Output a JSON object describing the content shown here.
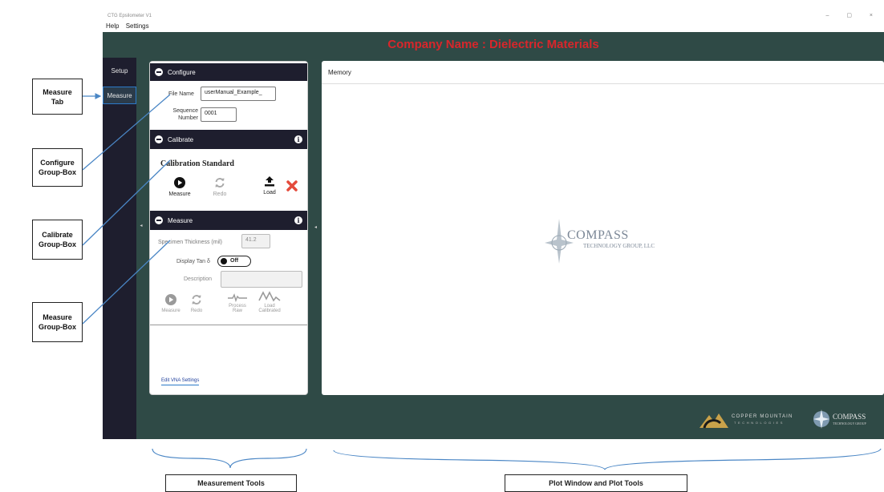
{
  "window": {
    "title": "CTG Epsilometer V1",
    "controls": "–  ▢  ×"
  },
  "menu": {
    "items": [
      "Help",
      "Settings"
    ]
  },
  "header": {
    "title": "Company Name : Dielectric Materials"
  },
  "nav": {
    "setup": "Setup",
    "measure": "Measure"
  },
  "configure": {
    "title": "Configure",
    "file_name_label": "File Name",
    "file_name_value": "userManual_Example_",
    "sequence_label_1": "Sequence",
    "sequence_label_2": "Number",
    "sequence_value": "0001"
  },
  "calibrate": {
    "title": "Calibrate",
    "standard_title": "Calibration Standard",
    "measure_label": "Measure",
    "redo_label": "Redo",
    "load_label": "Load"
  },
  "measure": {
    "title": "Measure",
    "thickness_label": "Specimen Thickness  (mil)",
    "thickness_value": "41.2",
    "display_tan_label": "Display Tan δ",
    "toggle_state": "Off",
    "description_label": "Description",
    "description_value": "",
    "measure_btn": "Measure",
    "redo_btn": "Redo",
    "process_btn_1": "Process",
    "process_btn_2": "Raw",
    "load_btn_1": "Load",
    "load_btn_2": "Calibrated"
  },
  "edit_vna": "Edit VNA Settings",
  "plot": {
    "tab": "Memory"
  },
  "logos": {
    "center_big": "COMPASS",
    "center_small": "TECHNOLOGY GROUP, LLC",
    "copper_1": "COPPER MOUNTAIN",
    "copper_2": "TECHNOLOGIES",
    "compass_foot_1": "COMPASS",
    "compass_foot_2": "TECHNOLOGY GROUP"
  },
  "callouts": {
    "measure_tab": [
      "Measure",
      "Tab"
    ],
    "configure": [
      "Configure",
      "Group-Box"
    ],
    "calibrate": [
      "Calibrate",
      "Group-Box"
    ],
    "measure": [
      "Measure",
      "Group-Box"
    ],
    "measurement_tools": "Measurement Tools",
    "plot_window": "Plot Window and Plot Tools"
  },
  "colors": {
    "header_bg": "#2f4a46",
    "title_red": "#d8262b",
    "nav_bg": "#1e1e2e",
    "accent_blue": "#2c7ac9"
  }
}
